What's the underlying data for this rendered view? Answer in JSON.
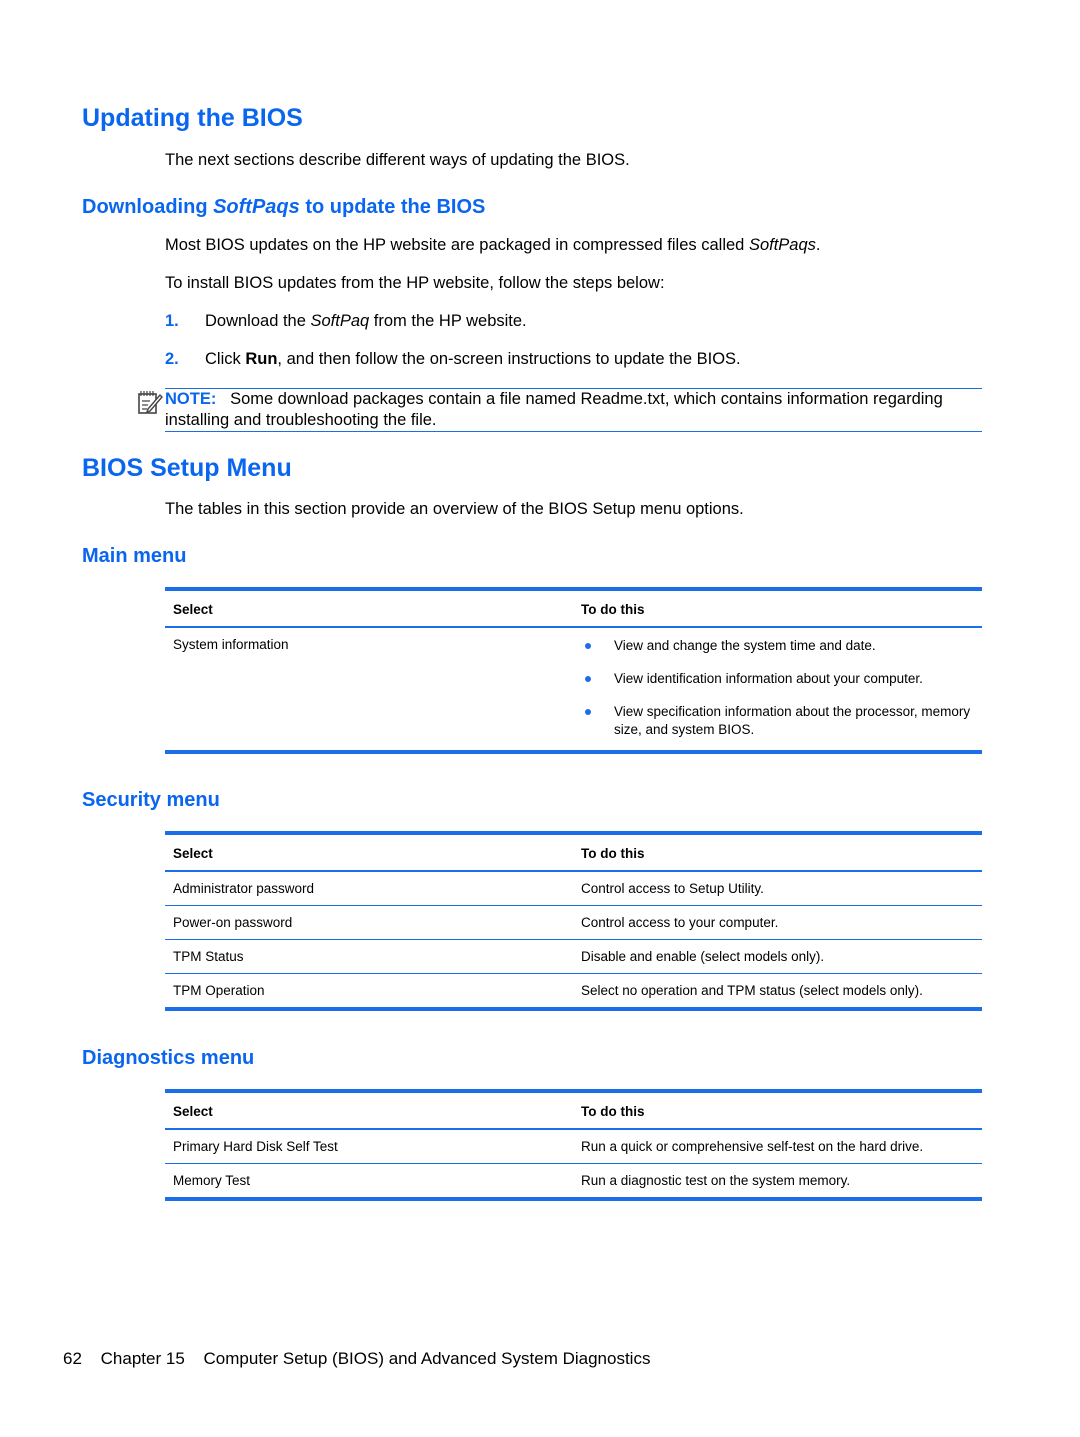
{
  "sections": {
    "updating": {
      "title": "Updating the BIOS",
      "intro": "The next sections describe different ways of updating the BIOS."
    },
    "downloading": {
      "title_pre": "Downloading ",
      "title_italic": "SoftPaqs",
      "title_post": " to update the BIOS",
      "para1_pre": "Most BIOS updates on the HP website are packaged in compressed files called ",
      "para1_italic": "SoftPaqs",
      "para1_post": ".",
      "para2": "To install BIOS updates from the HP website, follow the steps below:",
      "steps": [
        {
          "num": "1.",
          "pre": "Download the ",
          "italic": "SoftPaq",
          "post": " from the HP website."
        },
        {
          "num": "2.",
          "pre": "Click ",
          "bold": "Run",
          "post": ", and then follow the on-screen instructions to update the BIOS."
        }
      ],
      "note": {
        "icon": "note-pencil-icon",
        "label": "NOTE:",
        "text": "Some download packages contain a file named Readme.txt, which contains information regarding installing and troubleshooting the file."
      }
    },
    "setup_menu": {
      "title": "BIOS Setup Menu",
      "intro": "The tables in this section provide an overview of the BIOS Setup menu options."
    },
    "main_menu": {
      "title": "Main menu",
      "headers": [
        "Select",
        "To do this"
      ],
      "rows": [
        {
          "select": "System information",
          "bullets": [
            "View and change the system time and date.",
            "View identification information about your computer.",
            "View specification information about the processor, memory size, and system BIOS."
          ]
        }
      ]
    },
    "security_menu": {
      "title": "Security menu",
      "headers": [
        "Select",
        "To do this"
      ],
      "rows": [
        {
          "select": "Administrator password",
          "action": "Control access to Setup Utility."
        },
        {
          "select": "Power-on password",
          "action": "Control access to your computer."
        },
        {
          "select": "TPM Status",
          "action": "Disable and enable (select models only)."
        },
        {
          "select": "TPM Operation",
          "action": "Select no operation and TPM status (select models only)."
        }
      ]
    },
    "diagnostics_menu": {
      "title": "Diagnostics menu",
      "headers": [
        "Select",
        "To do this"
      ],
      "rows": [
        {
          "select": "Primary Hard Disk Self Test",
          "action": "Run a quick or comprehensive self-test on the hard drive."
        },
        {
          "select": "Memory Test",
          "action": "Run a diagnostic test on the system memory."
        }
      ]
    }
  },
  "footer": {
    "page_number": "62",
    "chapter": "Chapter 15",
    "chapter_title": "Computer Setup (BIOS) and Advanced System Diagnostics"
  },
  "colors": {
    "heading": "#0a66ee",
    "rule": "#1a6fe8"
  }
}
